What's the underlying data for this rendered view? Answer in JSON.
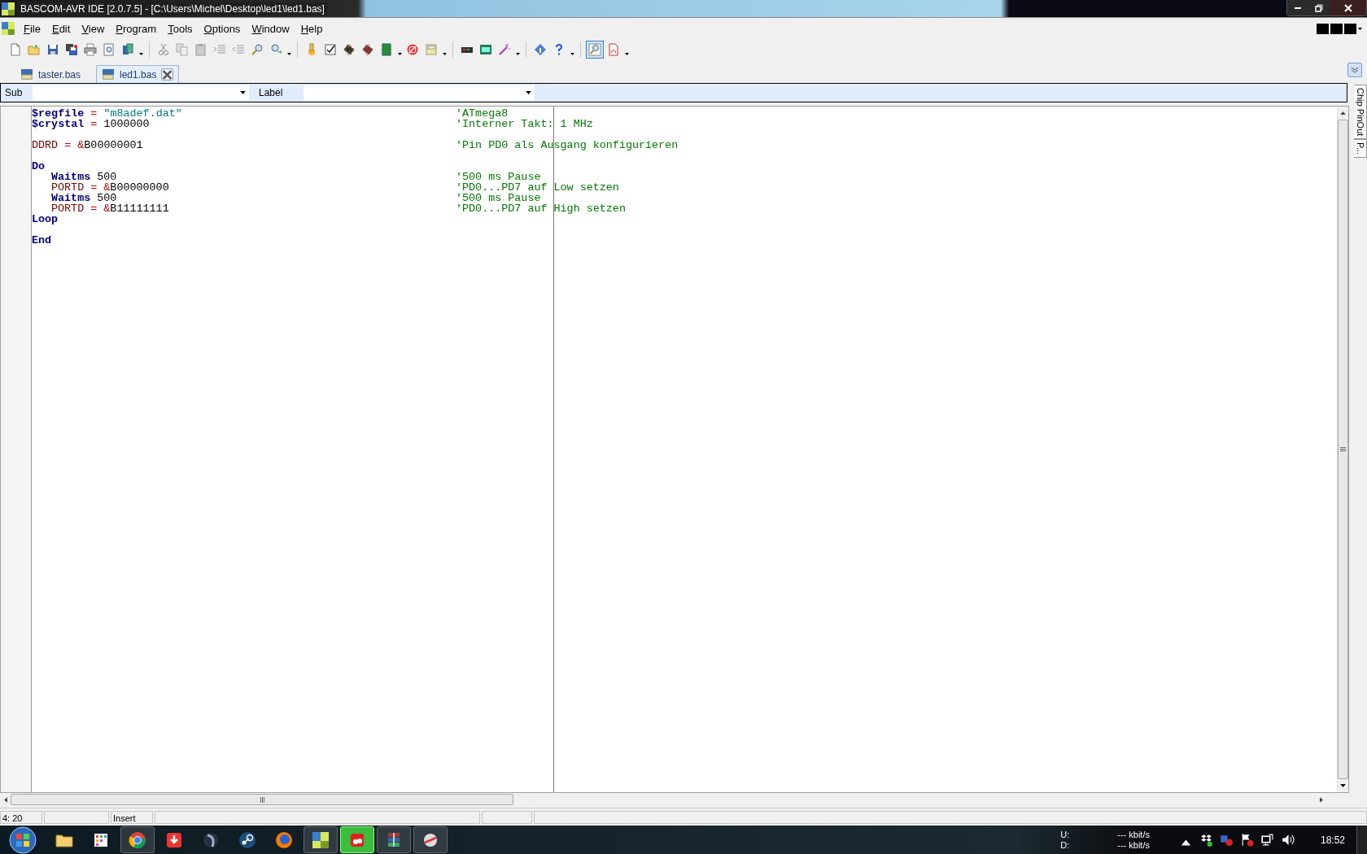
{
  "window": {
    "title": "BASCOM-AVR IDE [2.0.7.5] - [C:\\Users\\Michel\\Desktop\\led1\\led1.bas]"
  },
  "menu": [
    "File",
    "Edit",
    "View",
    "Program",
    "Tools",
    "Options",
    "Window",
    "Help"
  ],
  "toolbar": {
    "zoom_button": {
      "pressed": true
    }
  },
  "tabs": [
    {
      "label": "taster.bas",
      "selected": false
    },
    {
      "label": "led1.bas",
      "selected": true
    }
  ],
  "navigator": {
    "sub_label": "Sub",
    "label_label": "Label"
  },
  "side_panel": {
    "tabs": [
      "Chip PinOut",
      "P..."
    ]
  },
  "editor": {
    "lines": [
      {
        "kind": "code",
        "tokens": [
          {
            "kind": "keyword",
            "text": "$regfile"
          },
          {
            "kind": "op",
            "text": " = "
          },
          {
            "kind": "string",
            "text": "\"m8adef.dat\""
          }
        ],
        "comment": "'ATmega8"
      },
      {
        "kind": "code",
        "tokens": [
          {
            "kind": "keyword",
            "text": "$crystal"
          },
          {
            "kind": "op",
            "text": " = "
          },
          {
            "kind": "plain",
            "text": "1000000"
          }
        ],
        "comment": "'Interner Takt: 1 MHz"
      },
      {
        "kind": "blank"
      },
      {
        "kind": "code",
        "tokens": [
          {
            "kind": "register",
            "text": "DDRD"
          },
          {
            "kind": "op",
            "text": " = &"
          },
          {
            "kind": "plain",
            "text": "B00000001"
          }
        ],
        "comment": "'Pin PD0 als Ausgang konfigurieren"
      },
      {
        "kind": "blank"
      },
      {
        "kind": "code",
        "tokens": [
          {
            "kind": "keyword",
            "text": "Do"
          }
        ]
      },
      {
        "kind": "code",
        "indented": true,
        "tokens": [
          {
            "kind": "keyword",
            "text": "Waitms"
          },
          {
            "kind": "plain",
            "text": " 500"
          }
        ],
        "comment": "'500 ms Pause"
      },
      {
        "kind": "code",
        "indented": true,
        "tokens": [
          {
            "kind": "register",
            "text": "PORTD"
          },
          {
            "kind": "op",
            "text": " = &"
          },
          {
            "kind": "plain",
            "text": "B00000000"
          }
        ],
        "comment": "'PD0...PD7 auf Low setzen"
      },
      {
        "kind": "code",
        "indented": true,
        "tokens": [
          {
            "kind": "keyword",
            "text": "Waitms"
          },
          {
            "kind": "plain",
            "text": " 500"
          }
        ],
        "comment": "'500 ms Pause"
      },
      {
        "kind": "code",
        "indented": true,
        "tokens": [
          {
            "kind": "register",
            "text": "PORTD"
          },
          {
            "kind": "op",
            "text": " = &"
          },
          {
            "kind": "plain",
            "text": "B11111111"
          }
        ],
        "comment": "'PD0...PD7 auf High setzen"
      },
      {
        "kind": "code",
        "tokens": [
          {
            "kind": "keyword",
            "text": "Loop"
          }
        ]
      },
      {
        "kind": "blank"
      },
      {
        "kind": "code",
        "tokens": [
          {
            "kind": "keyword",
            "text": "End"
          }
        ]
      }
    ]
  },
  "status_bar": {
    "position": "4: 20",
    "mode": "Insert"
  },
  "taskbar": {
    "upload_label": "U:",
    "upload_rate": "--- kbit/s",
    "download_label": "D:",
    "download_rate": "--- kbit/s",
    "clock": "18:52"
  }
}
